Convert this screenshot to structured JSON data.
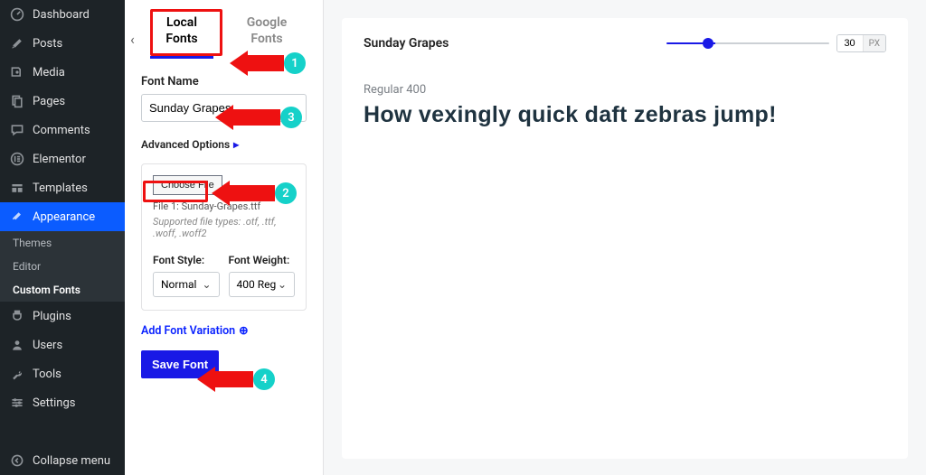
{
  "sidebar": {
    "items": [
      {
        "label": "Dashboard",
        "icon": "dashboard-icon"
      },
      {
        "label": "Posts",
        "icon": "pin-icon"
      },
      {
        "label": "Media",
        "icon": "media-icon"
      },
      {
        "label": "Pages",
        "icon": "pages-icon"
      },
      {
        "label": "Comments",
        "icon": "comments-icon"
      },
      {
        "label": "Elementor",
        "icon": "elementor-icon"
      },
      {
        "label": "Templates",
        "icon": "templates-icon"
      },
      {
        "label": "Appearance",
        "icon": "brush-icon",
        "active": true
      },
      {
        "label": "Plugins",
        "icon": "plug-icon"
      },
      {
        "label": "Users",
        "icon": "user-icon"
      },
      {
        "label": "Tools",
        "icon": "wrench-icon"
      },
      {
        "label": "Settings",
        "icon": "sliders-icon"
      }
    ],
    "subitems": [
      {
        "label": "Themes"
      },
      {
        "label": "Editor"
      },
      {
        "label": "Custom Fonts",
        "current": true
      }
    ],
    "collapse_label": "Collapse menu"
  },
  "tabs": {
    "local": "Local Fonts",
    "google": "Google Fonts"
  },
  "form": {
    "font_name_label": "Font Name",
    "font_name_value": "Sunday Grapes",
    "advanced_label": "Advanced Options",
    "choose_file_label": "Choose File",
    "file_line": "File 1: Sunday-Grapes.ttf",
    "supported_line": "Supported file types: .otf, .ttf, .woff, .woff2",
    "font_style_label": "Font Style:",
    "font_style_value": "Normal",
    "font_weight_label": "Font Weight:",
    "font_weight_value": "400 Reg",
    "add_variation_label": "Add Font Variation",
    "save_label": "Save Font"
  },
  "preview": {
    "title": "Sunday Grapes",
    "size_value": "30",
    "size_unit": "PX",
    "variant_label": "Regular 400",
    "sample_text": "How vexingly quick daft zebras jump!"
  },
  "annotations": {
    "b1": "1",
    "b2": "2",
    "b3": "3",
    "b4": "4"
  }
}
